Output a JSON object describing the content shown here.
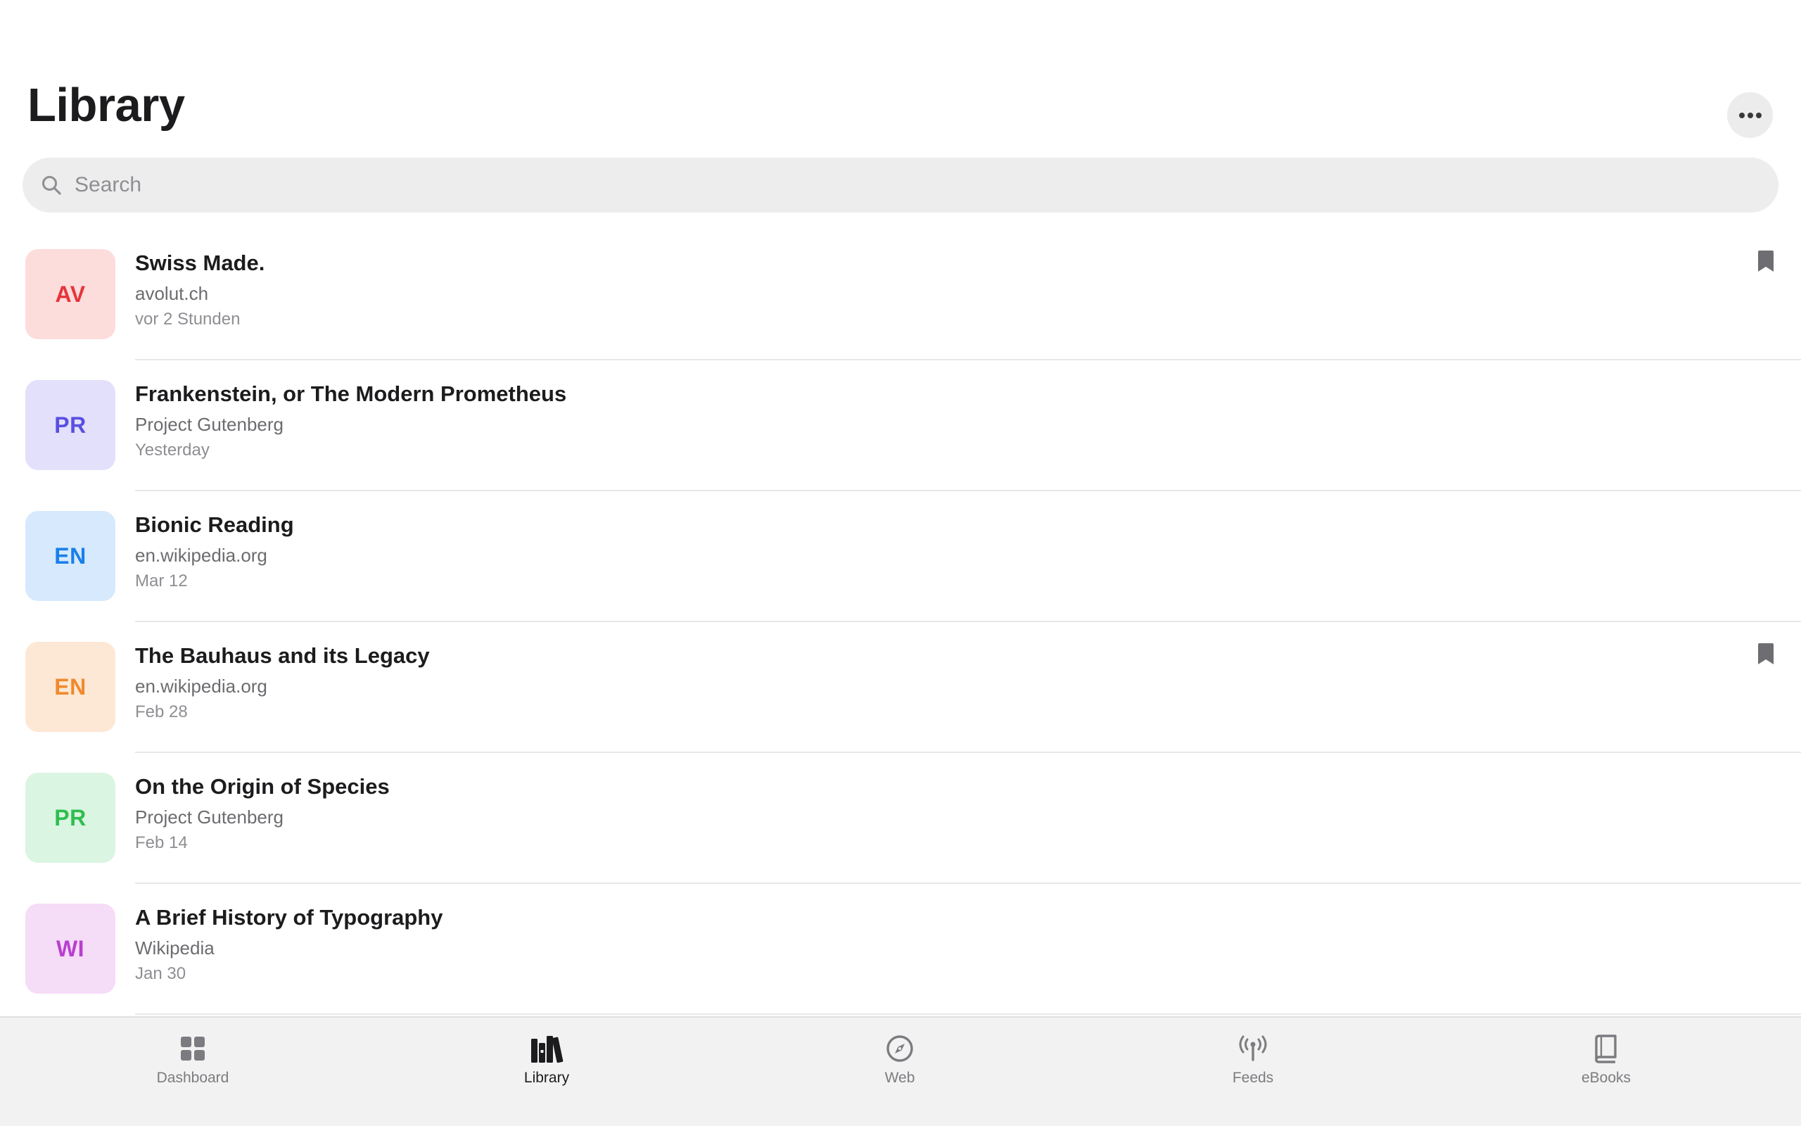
{
  "header": {
    "title": "Library",
    "more_icon": "ellipsis-icon"
  },
  "search": {
    "placeholder": "Search",
    "value": ""
  },
  "items": [
    {
      "initials": "AV",
      "title": "Swiss Made.",
      "source": "avolut.ch",
      "date": "vor 2 Stunden",
      "bookmarked": true,
      "bg": "#fddcdc",
      "fg": "#e5353b"
    },
    {
      "initials": "PR",
      "title": "Frankenstein, or The Modern Prometheus",
      "source": "Project Gutenberg",
      "date": "Yesterday",
      "bookmarked": false,
      "bg": "#e3e0fb",
      "fg": "#5a4fe0"
    },
    {
      "initials": "EN",
      "title": "Bionic Reading",
      "source": "en.wikipedia.org",
      "date": "Mar 12",
      "bookmarked": false,
      "bg": "#d6e9fd",
      "fg": "#1a7fe8"
    },
    {
      "initials": "EN",
      "title": "The Bauhaus and its Legacy",
      "source": "en.wikipedia.org",
      "date": "Feb 28",
      "bookmarked": true,
      "bg": "#fde7d5",
      "fg": "#f08a2c"
    },
    {
      "initials": "PR",
      "title": "On the Origin of Species",
      "source": "Project Gutenberg",
      "date": "Feb 14",
      "bookmarked": false,
      "bg": "#daf5e1",
      "fg": "#2fbe4f"
    },
    {
      "initials": "WI",
      "title": "A Brief History of Typography",
      "source": "Wikipedia",
      "date": "Jan 30",
      "bookmarked": false,
      "bg": "#f5dcf7",
      "fg": "#b83fd0"
    }
  ],
  "tabs": [
    {
      "label": "Dashboard",
      "icon": "grid-icon",
      "active": false
    },
    {
      "label": "Library",
      "icon": "books-icon",
      "active": true
    },
    {
      "label": "Web",
      "icon": "compass-icon",
      "active": false
    },
    {
      "label": "Feeds",
      "icon": "antenna-icon",
      "active": false
    },
    {
      "label": "eBooks",
      "icon": "book-icon",
      "active": false
    }
  ],
  "colors": {
    "accent_text": "#1c1c1e",
    "secondary_text": "#6c6c70",
    "tertiary_text": "#8e8e93",
    "bookmark": "#6e6e72"
  }
}
